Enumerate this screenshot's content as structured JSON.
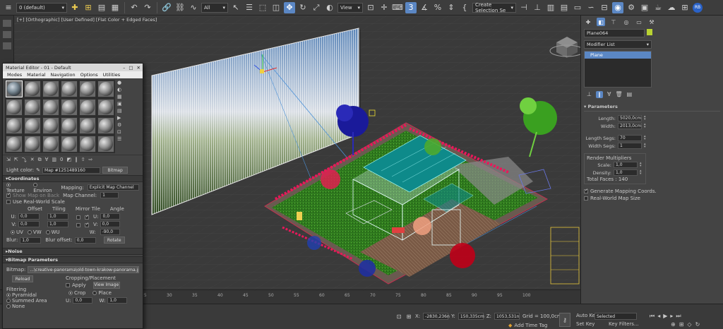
{
  "toolbar": {
    "layer_dropdown": "0 (default)",
    "filter_dropdown": "All",
    "view_dropdown": "View",
    "selection_set": "Create Selection Se",
    "badge": "RB"
  },
  "viewport": {
    "label": "[+] [Orthographic] [User Defined] [Flat Color + Edged Faces]"
  },
  "timeline": {
    "ticks": [
      "25",
      "30",
      "35",
      "40",
      "45",
      "50",
      "55",
      "60",
      "65",
      "70",
      "75",
      "80",
      "85",
      "90",
      "95",
      "100"
    ]
  },
  "status": {
    "x_label": "X:",
    "x_value": "-2830,236n",
    "y_label": "Y:",
    "y_value": "150,335cm",
    "z_label": "Z:",
    "z_value": "1053,531n",
    "grid": "Grid = 100,0cm",
    "add_time_tag": "Add Time Tag",
    "auto_key": "Auto Key",
    "set_key": "Set Key",
    "selected": "Selected",
    "key_filters": "Key Filters..."
  },
  "command_panel": {
    "object_name": "Plane064",
    "object_color": "#b8d232",
    "modifier_list": "Modifier List",
    "stack_item": "Plane",
    "params_header": "Parameters",
    "length_label": "Length:",
    "length_value": "5020,0cm",
    "width_label": "Width:",
    "width_value": "2013,0cm",
    "length_segs_label": "Length Segs:",
    "length_segs_value": "70",
    "width_segs_label": "Width Segs:",
    "width_segs_value": "1",
    "render_mult_label": "Render Multipliers",
    "scale_label": "Scale:",
    "scale_value": "1,0",
    "density_label": "Density:",
    "density_value": "1,0",
    "total_faces": "Total Faces : 140",
    "gen_mapping": "Generate Mapping Coords.",
    "real_world": "Real-World Map Size"
  },
  "material_editor": {
    "title": "Material Editor - 01 - Default",
    "menu": [
      "Modes",
      "Material",
      "Navigation",
      "Options",
      "Utilities"
    ],
    "light_color_label": "Light color:",
    "map_name": "Map #1251489160",
    "map_type": "Bitmap",
    "coordinates_header": "Coordinates",
    "texture_label": "Texture",
    "environ_label": "Environ",
    "mapping_label": "Mapping:",
    "mapping_value": "Explicit Map Channel",
    "show_map_label": "Show Map on Back",
    "map_channel_label": "Map Channel:",
    "map_channel_value": "1",
    "use_real_world": "Use Real-World Scale",
    "offset_header": "Offset",
    "tiling_header": "Tiling",
    "mirror_tile_header": "Mirror Tile",
    "angle_header": "Angle",
    "u_label": "U:",
    "v_label": "V:",
    "w_label": "W:",
    "u_offset": "0,0",
    "v_offset": "0,0",
    "u_tiling": "1,0",
    "v_tiling": "1,0",
    "u_angle": "0,0",
    "v_angle": "0,0",
    "w_angle": "-90,0",
    "uv_label": "UV",
    "vw_label": "VW",
    "wu_label": "WU",
    "blur_label": "Blur:",
    "blur_value": "1,0",
    "blur_offset_label": "Blur offset:",
    "blur_offset_value": "0,0",
    "rotate_label": "Rotate",
    "noise_header": "Noise",
    "bitmap_params_header": "Bitmap Parameters",
    "bitmap_label": "Bitmap:",
    "bitmap_path": "...\\creative-panorama\\old-town-krakow-panorama.jpg",
    "reload_label": "Reload",
    "cropping_label": "Cropping/Placement",
    "apply_label": "Apply",
    "view_image_label": "View Image",
    "filtering_label": "Filtering",
    "pyramidal_label": "Pyramidal",
    "summed_area_label": "Summed Area",
    "none_label": "None",
    "crop_label": "Crop",
    "place_label": "Place",
    "crop_u_label": "U:",
    "crop_u_value": "0,0",
    "crop_w_label": "W:",
    "crop_w_value": "1,0"
  }
}
